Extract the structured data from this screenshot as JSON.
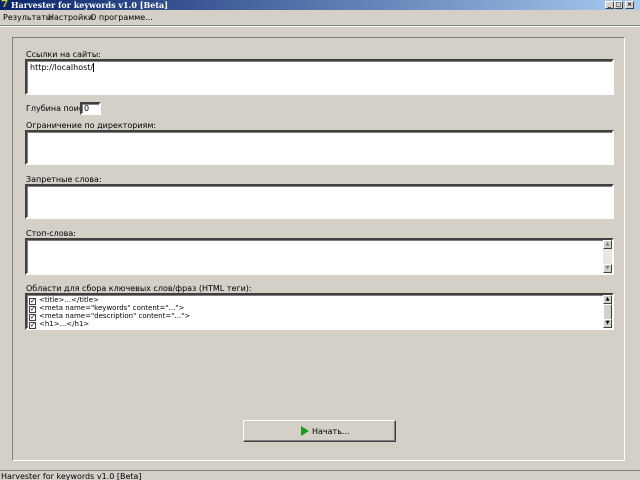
{
  "window": {
    "title": "Harvester for keywords v1.0 [Beta]",
    "icon_glyph": "7",
    "min_glyph": "_",
    "max_glyph": "□",
    "close_glyph": "×"
  },
  "menu": [
    "Результаты",
    "Настройки",
    "О программе..."
  ],
  "form": {
    "links_label": "Ссылки на сайты:",
    "links_value": "http://localhost/",
    "depth_label": "Глубина поиска:",
    "depth_value": "0",
    "dir_limit_label": "Ограничение по директориям:",
    "forbidden_label": "Запретные слова:",
    "stopwords_label": "Стоп-слова:",
    "areas_label": "Области для сбора ключевых слов/фраз (HTML теги):",
    "areas": [
      {
        "text": "<title>...</title>",
        "checked": true
      },
      {
        "text": "<meta name=\"keywords\" content=\"...\">",
        "checked": true
      },
      {
        "text": "<meta name=\"description\" content=\"...\">",
        "checked": true
      },
      {
        "text": "<h1>...</h1>",
        "checked": true
      }
    ],
    "check_glyph": "✓"
  },
  "start_button": {
    "label": "Начать...",
    "icon": "play-icon",
    "icon_color": "#1a9d1a"
  },
  "status": {
    "text": "Harvester for keywords v1.0 [Beta]"
  },
  "scroll_glyphs": {
    "up": "▲",
    "down": "▼"
  }
}
